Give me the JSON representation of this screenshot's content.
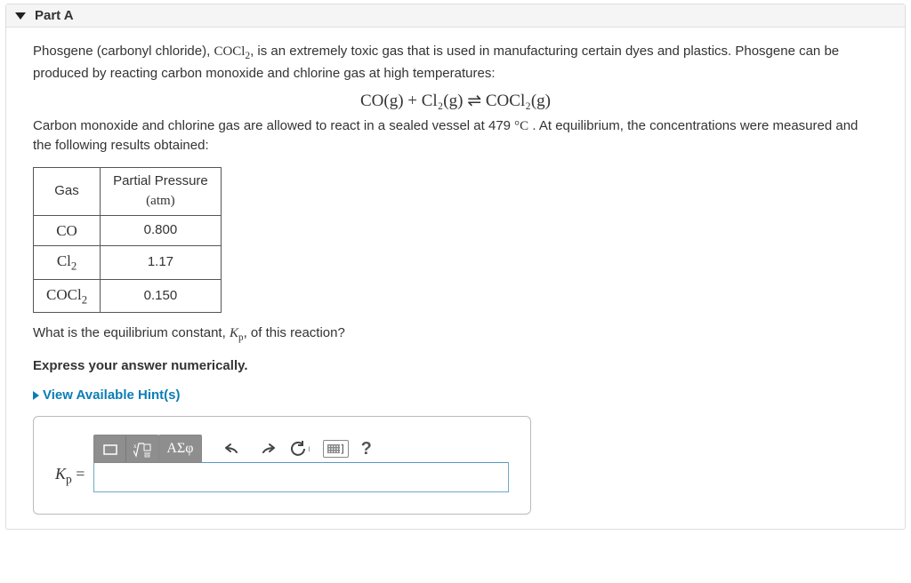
{
  "part": {
    "label": "Part A"
  },
  "text": {
    "intro1_a": "Phosgene (carbonyl chloride), ",
    "intro1_formula": "COCl",
    "intro1_sub": "2",
    "intro1_b": ", is an extremely toxic gas that is used in manufacturing certain dyes and plastics. Phosgene can be produced by reacting carbon monoxide and chlorine gas at high temperatures:",
    "equation": "CO(g) + Cl₂(g) ⇌ COCl₂(g)",
    "intro2_a": "Carbon monoxide and chlorine gas are allowed to react in a sealed vessel at 479 ",
    "intro2_deg": "°C",
    "intro2_b": " . At equilibrium, the concentrations were measured and the following results obtained:",
    "question_a": "What is the equilibrium constant, ",
    "kp_var": "K",
    "kp_sub": "p",
    "question_b": ", of this reaction?",
    "express": "Express your answer numerically.",
    "hints": "View Available Hint(s)",
    "greek_label": "ΑΣφ",
    "help": "?",
    "kp_equals": " ="
  },
  "table": {
    "h1": "Gas",
    "h2_a": "Partial Pressure",
    "h2_b": "(atm)",
    "r1c1": "CO",
    "r1c2": "0.800",
    "r2c1_a": "Cl",
    "r2c1_sub": "2",
    "r2c2": "1.17",
    "r3c1_a": "COCl",
    "r3c1_sub": "2",
    "r3c2": "0.150"
  },
  "input": {
    "value": ""
  }
}
